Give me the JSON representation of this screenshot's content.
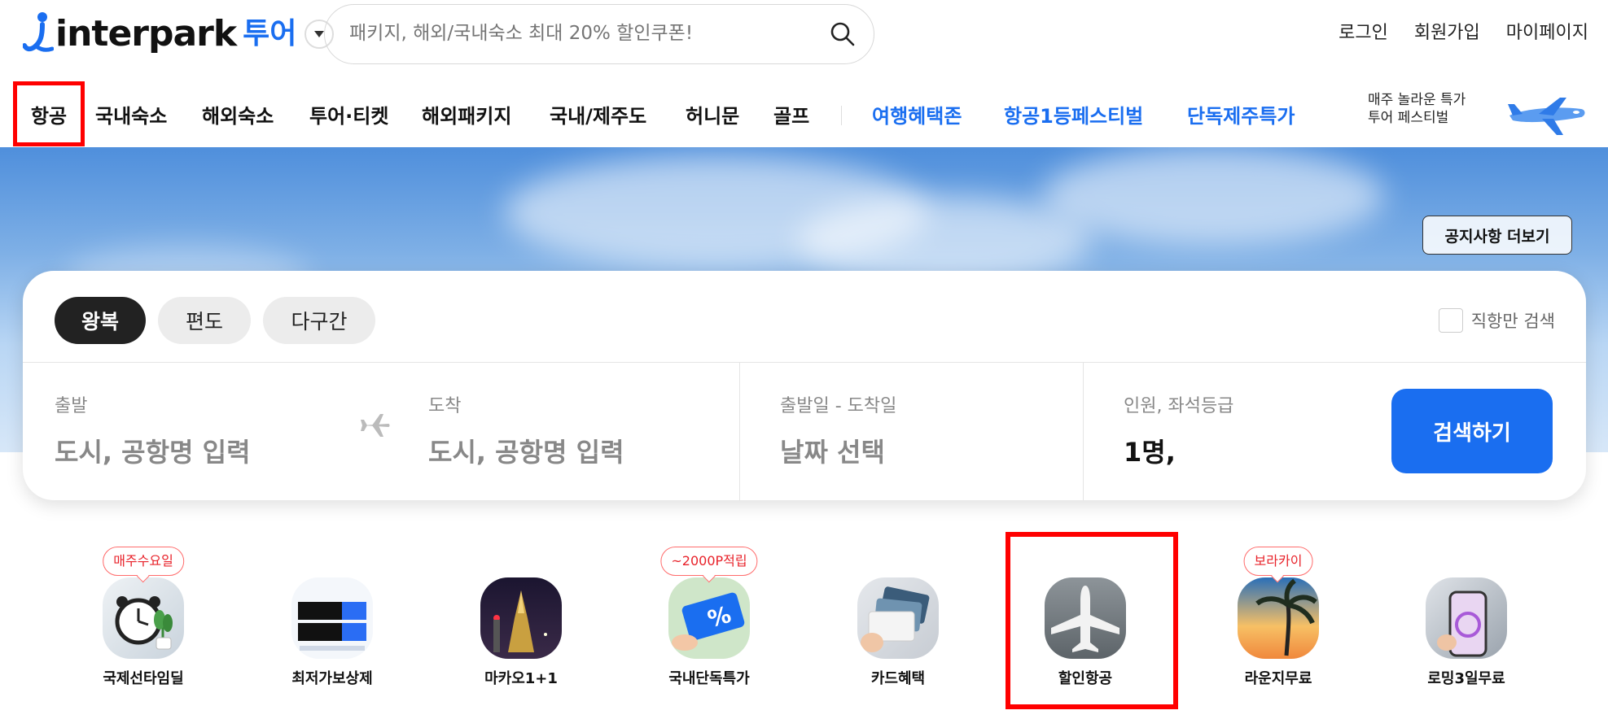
{
  "header": {
    "logo_text": "interpark",
    "logo_sub": "투어",
    "search_placeholder": "패키지, 해외/국내숙소 최대 20% 할인쿠폰!",
    "links": [
      "로그인",
      "회원가입",
      "마이페이지"
    ]
  },
  "nav": {
    "items": [
      "항공",
      "국내숙소",
      "해외숙소",
      "투어·티켓",
      "해외패키지",
      "국내/제주도",
      "허니문",
      "골프"
    ],
    "highlight_items": [
      "여행혜택존",
      "항공1등페스티벌",
      "단독제주특가"
    ],
    "promo_line1": "매주 놀라운 특가",
    "promo_line2": "투어 페스티벌"
  },
  "hero": {
    "notice_button": "공지사항 더보기"
  },
  "search_panel": {
    "trip_types": [
      "왕복",
      "편도",
      "다구간"
    ],
    "direct_only": "직항만 검색",
    "departure_label": "출발",
    "departure_value": "도시, 공항명 입력",
    "arrival_label": "도착",
    "arrival_value": "도시, 공항명 입력",
    "dates_label": "출발일 - 도착일",
    "dates_value": "날짜 선택",
    "passengers_label": "인원, 좌석등급",
    "passengers_value": "1명,",
    "search_button": "검색하기"
  },
  "quick_menu": [
    {
      "label": "국제선타임딜",
      "badge": "매주수요일"
    },
    {
      "label": "최저가보상제",
      "badge": ""
    },
    {
      "label": "마카오1+1",
      "badge": ""
    },
    {
      "label": "국내단독특가",
      "badge": "~2000P적립"
    },
    {
      "label": "카드혜택",
      "badge": ""
    },
    {
      "label": "할인항공",
      "badge": ""
    },
    {
      "label": "라운지무료",
      "badge": "보라카이"
    },
    {
      "label": "로밍3일무료",
      "badge": ""
    }
  ],
  "colors": {
    "brand_blue": "#1a6ef0",
    "badge_red": "#e8222a",
    "highlight_red": "#ff0000"
  }
}
